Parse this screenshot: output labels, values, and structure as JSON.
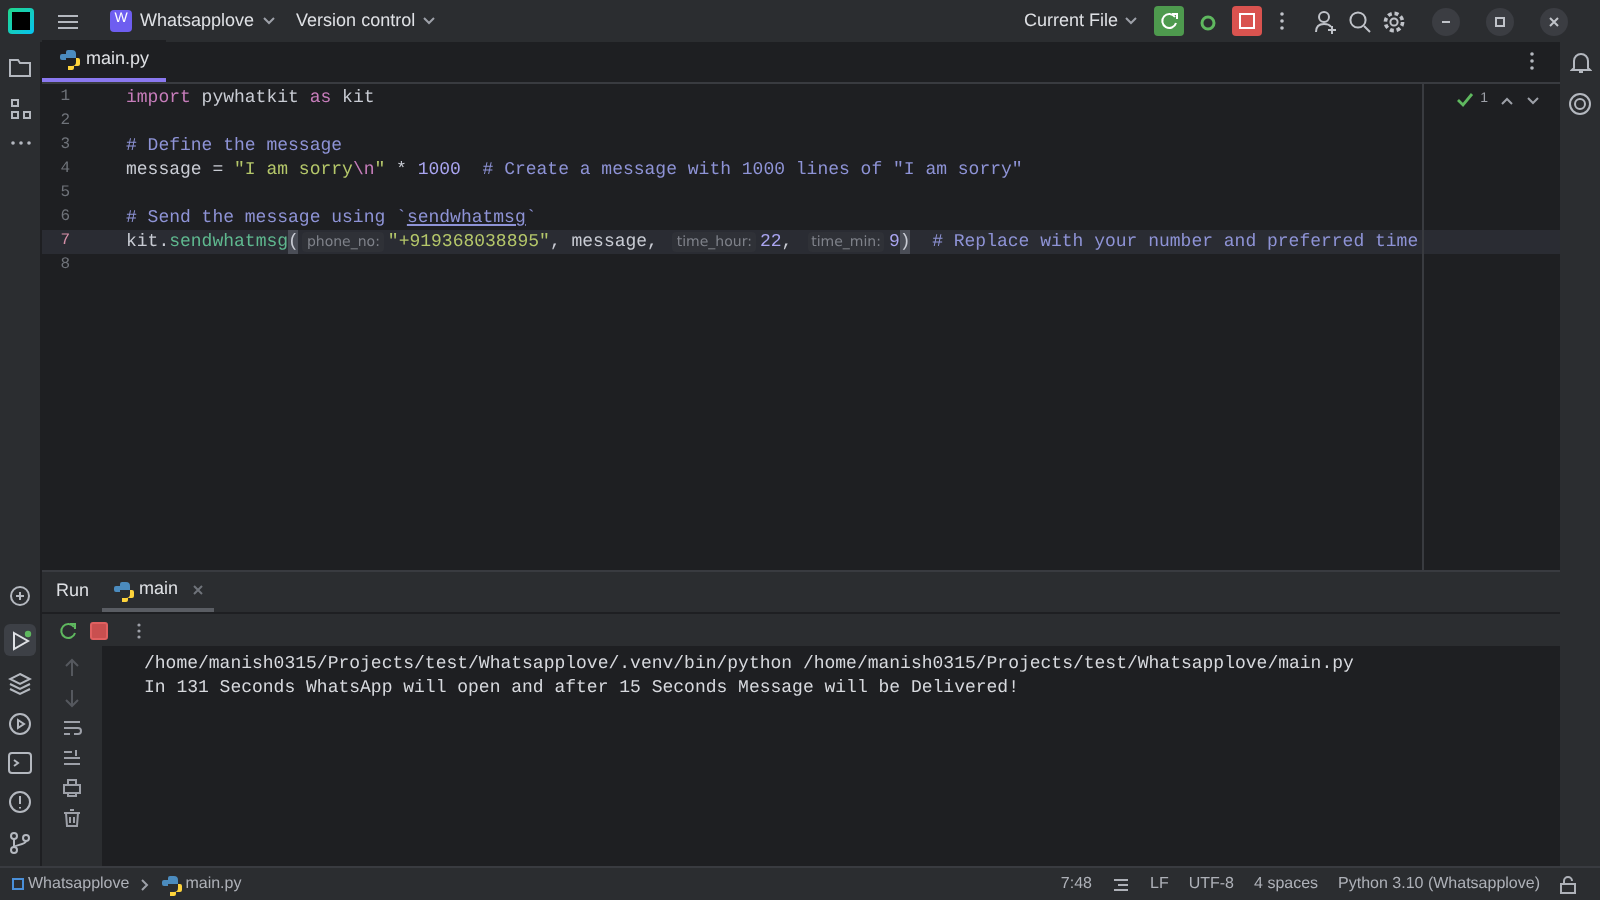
{
  "title_bar": {
    "project": {
      "initial": "W",
      "name": "Whatsapplove"
    },
    "vcs": "Version control",
    "run_config": "Current File"
  },
  "editor_tabs": [
    {
      "label": "main.py",
      "selected": true
    }
  ],
  "inspection": {
    "count": "1"
  },
  "code_lines": [
    {
      "number": "1",
      "current": false,
      "tokens": [
        {
          "kind": "kw",
          "text": "import"
        },
        {
          "kind": "plain",
          "text": " pywhatkit "
        },
        {
          "kind": "kw",
          "text": "as"
        },
        {
          "kind": "plain",
          "text": " kit"
        }
      ]
    },
    {
      "number": "2",
      "current": false
    },
    {
      "number": "3",
      "current": false,
      "tokens": [
        {
          "kind": "comment",
          "text": "# Define the message"
        }
      ]
    },
    {
      "number": "4",
      "current": false,
      "tokens": [
        {
          "kind": "plain",
          "text": "message = "
        },
        {
          "kind": "str",
          "text": "\"I am sorry"
        },
        {
          "kind": "esc",
          "text": "\\n"
        },
        {
          "kind": "str",
          "text": "\""
        },
        {
          "kind": "plain",
          "text": " * "
        },
        {
          "kind": "num",
          "text": "1000"
        },
        {
          "kind": "comment",
          "text": "  # Create a message with 1000 lines of \"I am sorry\""
        }
      ]
    },
    {
      "number": "5",
      "current": false
    },
    {
      "number": "6",
      "current": false,
      "tokens": [
        {
          "kind": "comment",
          "text": "# Send the message using `"
        },
        {
          "kind": "comment_ref",
          "text": "sendwhatmsg"
        },
        {
          "kind": "comment",
          "text": "`"
        }
      ]
    },
    {
      "number": "7",
      "current": true,
      "tokens": [
        {
          "kind": "plain",
          "text": "kit."
        },
        {
          "kind": "fn",
          "text": "sendwhatmsg"
        },
        {
          "kind": "bracket",
          "text": "("
        },
        {
          "kind": "hint",
          "text": "phone_no:"
        },
        {
          "kind": "str",
          "text": "\"+919368038895\""
        },
        {
          "kind": "plain",
          "text": ", message, "
        },
        {
          "kind": "hint",
          "text": "time_hour:"
        },
        {
          "kind": "num",
          "text": "22"
        },
        {
          "kind": "plain",
          "text": ", "
        },
        {
          "kind": "hint",
          "text": "time_min:"
        },
        {
          "kind": "num",
          "text": "9"
        },
        {
          "kind": "bracket",
          "text": ")"
        },
        {
          "kind": "comment",
          "text": "  # Replace with your number and preferred time"
        }
      ]
    },
    {
      "number": "8",
      "current": false
    }
  ],
  "run_panel": {
    "title": "Run",
    "tabs": [
      {
        "label": "main",
        "selected": true
      }
    ],
    "console": [
      "/home/manish0315/Projects/test/Whatsapplove/.venv/bin/python /home/manish0315/Projects/test/Whatsapplove/main.py",
      "In 131 Seconds WhatsApp will open and after 15 Seconds Message will be Delivered!"
    ]
  },
  "status_bar": {
    "breadcrumbs": [
      "Whatsapplove",
      "main.py"
    ],
    "position": "7:48",
    "items": [
      "LF",
      "UTF-8",
      "4 spaces",
      "Python 3.10 (Whatsapplove)"
    ]
  }
}
